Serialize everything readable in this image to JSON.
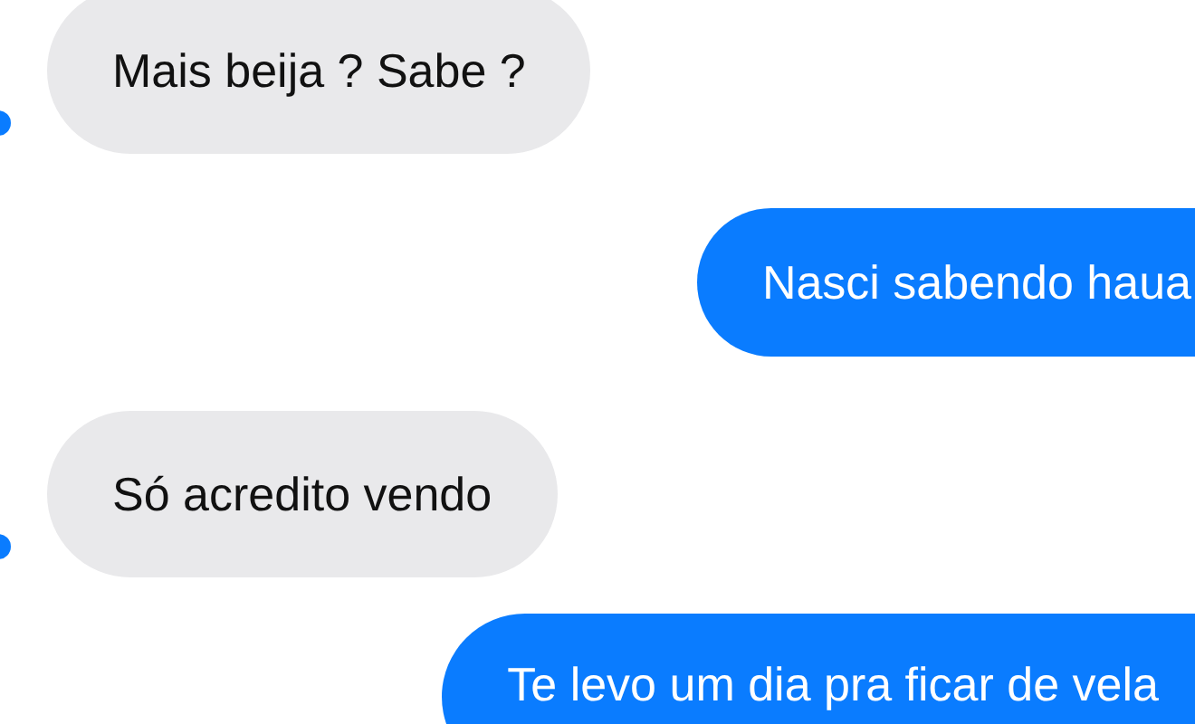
{
  "messages": [
    {
      "kind": "received",
      "text": "Mais beija ? Sabe ?"
    },
    {
      "kind": "sent",
      "text": "Nasci sabendo haua"
    },
    {
      "kind": "received",
      "text": "Só acredito vendo"
    },
    {
      "kind": "sent",
      "text": "Te levo um dia pra ficar de vela"
    }
  ]
}
